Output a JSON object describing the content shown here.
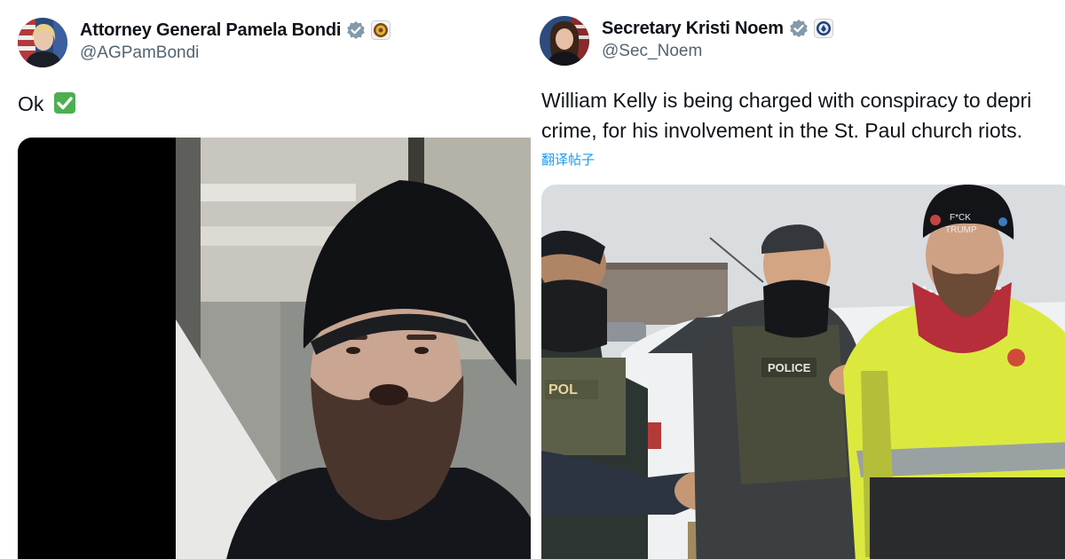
{
  "left_tweet": {
    "display_name": "Attorney General Pamela Bondi",
    "handle": "@AGPamBondi",
    "text": "Ok",
    "emoji": "check-mark-emoji",
    "avatar": "avatar-pamela-bondi",
    "badges": [
      "verified-badge-icon",
      "government-seal-icon"
    ],
    "media": "video-still-bearded-man-black-beanie"
  },
  "right_tweet": {
    "display_name": "Secretary Kristi Noem",
    "handle": "@Sec_Noem",
    "text_line1": "William Kelly is being charged with conspiracy to depri",
    "text_line2": "crime, for his involvement in the St. Paul church riots.",
    "translate_link": "翻译帖子",
    "avatar": "avatar-kristi-noem",
    "badges": [
      "verified-badge-icon",
      "government-seal-icon"
    ],
    "media": "photo-arrest-police-officers",
    "photo_text": {
      "vest_label_1": "POLICE",
      "vest_label_2": "POL",
      "beanie_line_1": "F*CK",
      "beanie_line_2": "TRUMP"
    }
  },
  "colors": {
    "verified_blue": "#829aab",
    "handle_gray": "#536471",
    "link_blue": "#1d9bf0",
    "text": "#0f1419",
    "check_green": "#4caf50",
    "hi_vis_yellow": "#d8e83a"
  }
}
